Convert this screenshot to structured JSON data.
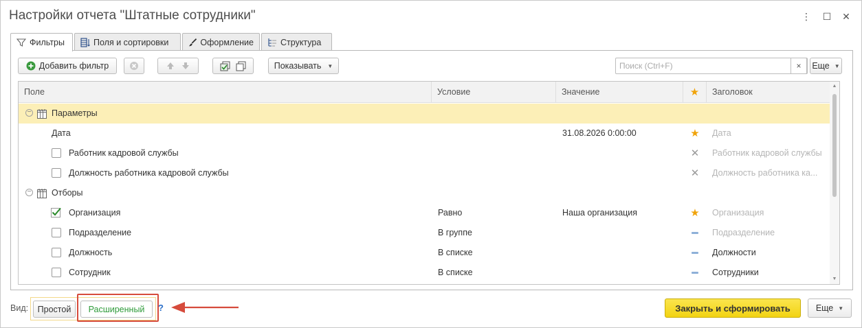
{
  "window": {
    "title": "Настройки отчета \"Штатные сотрудники\"",
    "menu_glyph": "⋮",
    "maximize_glyph": "☐",
    "close_glyph": "✕"
  },
  "tabs": [
    {
      "label": "Фильтры",
      "icon": "filter-icon",
      "active": true
    },
    {
      "label": "Поля и сортировки",
      "icon": "columns-sort-icon",
      "active": false
    },
    {
      "label": "Оформление",
      "icon": "brush-icon",
      "active": false
    },
    {
      "label": "Структура",
      "icon": "structure-icon",
      "active": false
    }
  ],
  "toolbar": {
    "add_filter_label": "Добавить фильтр",
    "show_label": "Показывать",
    "search_placeholder": "Поиск (Ctrl+F)",
    "search_value": "",
    "search_clear_glyph": "×",
    "more_label": "Еще"
  },
  "grid": {
    "headers": {
      "field": "Поле",
      "condition": "Условие",
      "value": "Значение",
      "star_glyph": "★",
      "caption": "Заголовок"
    },
    "rows": [
      {
        "kind": "group",
        "field": "Параметры",
        "selected": true,
        "icon": "parameters-icon"
      },
      {
        "kind": "item",
        "field": "Дата",
        "condition": "",
        "value": "31.08.2026 0:00:00",
        "mark": "star",
        "caption": "Дата",
        "caption_muted": true,
        "checkbox": "none"
      },
      {
        "kind": "item",
        "field": "Работник кадровой службы",
        "condition": "",
        "value": "",
        "mark": "x",
        "caption": "Работник кадровой службы",
        "caption_muted": true,
        "checkbox": "unchecked"
      },
      {
        "kind": "item",
        "field": "Должность работника кадровой службы",
        "condition": "",
        "value": "",
        "mark": "x",
        "caption": "Должность работника ка...",
        "caption_muted": true,
        "checkbox": "unchecked"
      },
      {
        "kind": "group",
        "field": "Отборы",
        "selected": false,
        "icon": "filters-group-icon"
      },
      {
        "kind": "item",
        "field": "Организация",
        "condition": "Равно",
        "value": "Наша организация",
        "mark": "star",
        "caption": "Организация",
        "caption_muted": true,
        "checkbox": "checked"
      },
      {
        "kind": "item",
        "field": "Подразделение",
        "condition": "В группе",
        "value": "",
        "mark": "dash",
        "caption": "Подразделение",
        "caption_muted": true,
        "checkbox": "unchecked"
      },
      {
        "kind": "item",
        "field": "Должность",
        "condition": "В списке",
        "value": "",
        "mark": "dash",
        "caption": "Должности",
        "caption_muted": false,
        "checkbox": "unchecked"
      },
      {
        "kind": "item",
        "field": "Сотрудник",
        "condition": "В списке",
        "value": "",
        "mark": "dash",
        "caption": "Сотрудники",
        "caption_muted": false,
        "checkbox": "unchecked"
      }
    ]
  },
  "footer": {
    "view_label": "Вид:",
    "simple_label": "Простой",
    "extended_label": "Расширенный",
    "help_label": "?",
    "primary_label": "Закрыть и сформировать",
    "more_label": "Еще"
  },
  "colors": {
    "selected_row": "#fcefb7",
    "primary_button": "#f5d91f",
    "star": "#f0a30a",
    "annotation_red": "#d64b3c",
    "extended_text": "#2e9b3a"
  }
}
